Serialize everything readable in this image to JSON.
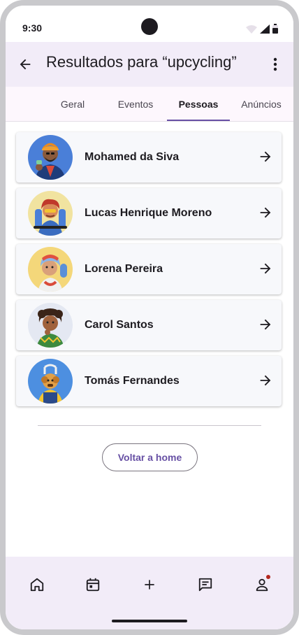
{
  "status_bar": {
    "time": "9:30"
  },
  "app_bar": {
    "title": "Resultados para “upcycling”",
    "back_icon": "arrow-back-icon",
    "more_icon": "more-vert-icon"
  },
  "tabs": [
    {
      "label": "Geral",
      "active": false
    },
    {
      "label": "Eventos",
      "active": false
    },
    {
      "label": "Pessoas",
      "active": true
    },
    {
      "label": "Anúncios",
      "active": false
    }
  ],
  "people": [
    {
      "name": "Mohamed da Siva",
      "avatar_bg": "#4a7fd8"
    },
    {
      "name": "Lucas Henrique Moreno",
      "avatar_bg": "#f1e3a0"
    },
    {
      "name": "Lorena Pereira",
      "avatar_bg": "#f4d77a"
    },
    {
      "name": "Carol Santos",
      "avatar_bg": "#e4e8f2"
    },
    {
      "name": "Tomás Fernandes",
      "avatar_bg": "#4d8fe0"
    }
  ],
  "home_button": {
    "label": "Voltar a home"
  },
  "bottom_nav": [
    {
      "icon": "home-icon"
    },
    {
      "icon": "calendar-icon"
    },
    {
      "icon": "add-icon"
    },
    {
      "icon": "chat-icon"
    },
    {
      "icon": "profile-icon",
      "badge": true
    }
  ],
  "colors": {
    "accent": "#6750a4",
    "surface_tint": "#f2ecf8",
    "badge": "#b3261e"
  }
}
